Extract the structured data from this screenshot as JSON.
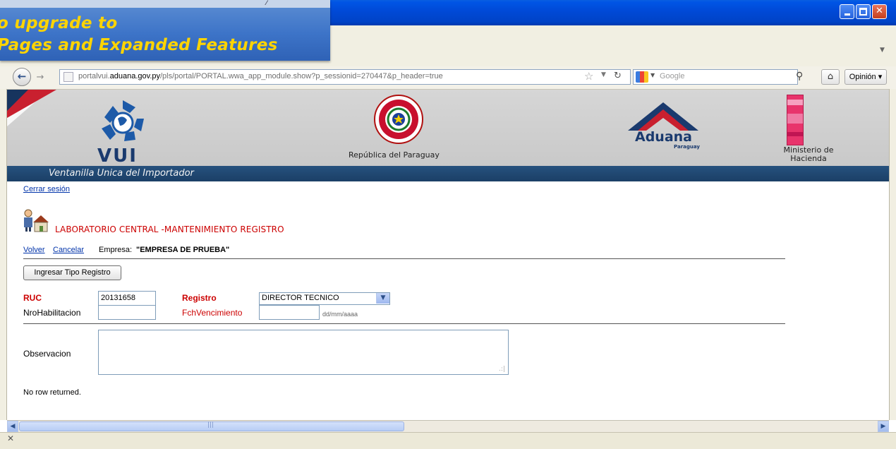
{
  "browser": {
    "url_prefix": "portalvui.",
    "url_domain": "aduana.gov.py",
    "url_rest": "/pls/portal/PORTAL.wwa_app_module.show?p_sessionid=270447&p_header=true",
    "search_engine": "Google",
    "opinion_label": "Opinión"
  },
  "promo": {
    "line1": "o upgrade to",
    "line2": "Pages and Expanded Features"
  },
  "banner": {
    "vui_text": "VUI",
    "republic_label": "República del Paraguay",
    "aduana_label": "Aduana",
    "aduana_sub": "Paraguay",
    "hacienda_label": "Ministerio de Hacienda",
    "subtitle": "Ventanilla Unica del Importador",
    "colors": {
      "navy": "#1b3f66",
      "red": "#c9202f",
      "accent_red": "#cc0000"
    }
  },
  "content": {
    "logout": "Cerrar sesión",
    "title": "LABORATORIO CENTRAL -MANTENIMIENTO REGISTRO",
    "volver": "Volver",
    "cancelar": "Cancelar",
    "empresa_label": "Empresa:",
    "empresa_value": "\"EMPRESA DE PRUEBA\"",
    "ingresar_button": "Ingresar Tipo Registro",
    "ruc_label": "RUC",
    "ruc_value": "20131658",
    "registro_label": "Registro",
    "registro_value": "DIRECTOR TECNICO",
    "nrohab_label": "NroHabilitacion",
    "nrohab_value": "",
    "fchvenc_label": "FchVencimiento",
    "fchvenc_value": "",
    "date_hint": "dd/mm/aaaa",
    "observacion_label": "Observacion",
    "no_rows": "No row returned."
  },
  "icons": {
    "back": "back-arrow-icon",
    "forward": "forward-arrow-icon",
    "home": "home-icon",
    "search": "magnifier-icon",
    "bookmark": "star-icon",
    "reload": "reload-icon"
  }
}
